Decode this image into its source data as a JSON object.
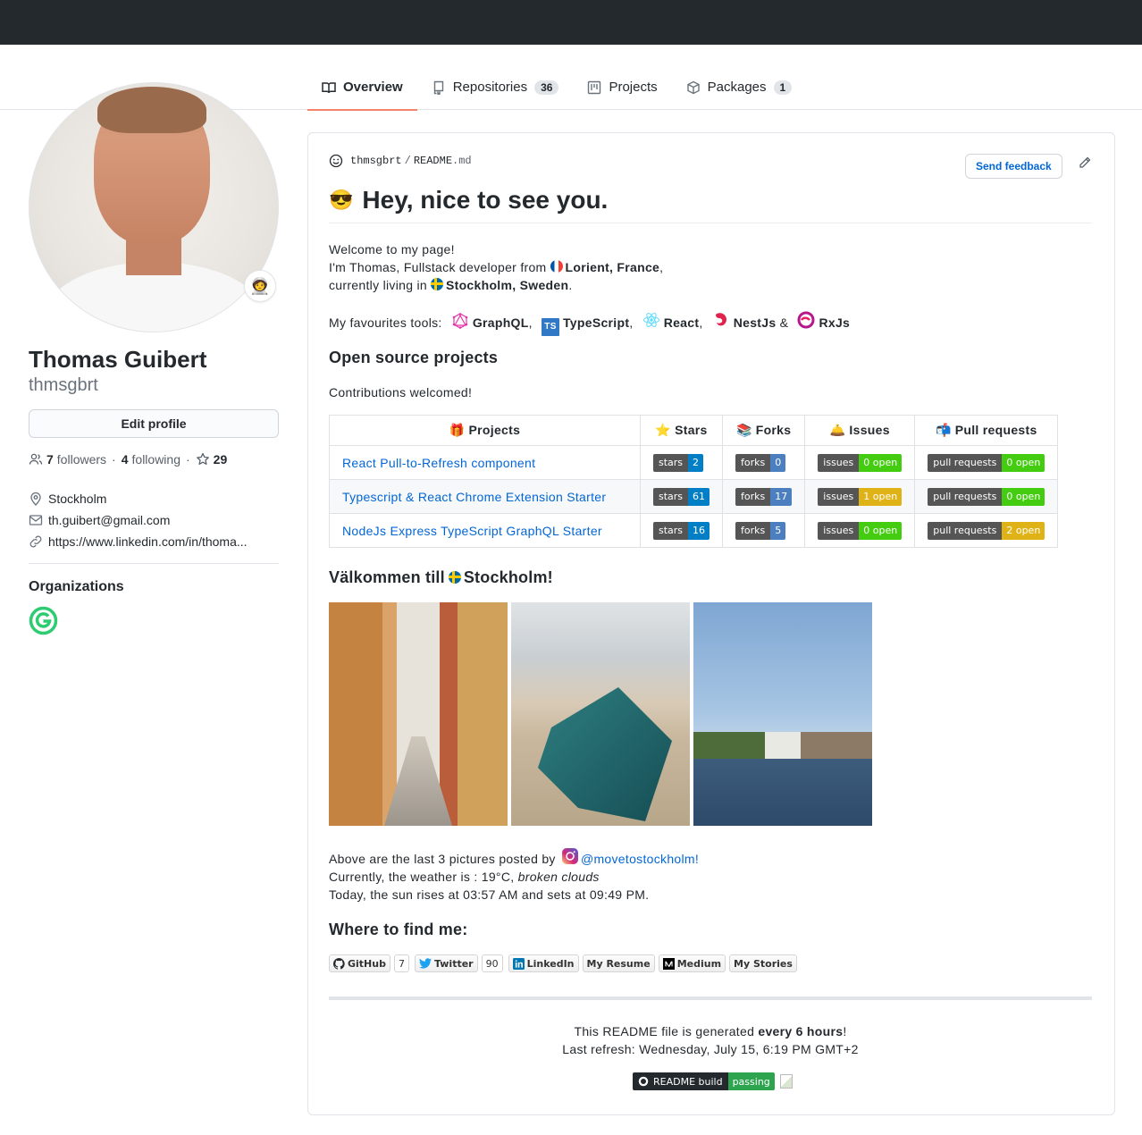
{
  "tabs": [
    {
      "label": "Overview",
      "icon": "book-icon",
      "active": true
    },
    {
      "label": "Repositories",
      "icon": "repo-icon",
      "count": "36"
    },
    {
      "label": "Projects",
      "icon": "project-icon"
    },
    {
      "label": "Packages",
      "icon": "package-icon",
      "count": "1"
    }
  ],
  "profile": {
    "name": "Thomas Guibert",
    "login": "thmsgbrt",
    "status_emoji": "🧑‍🚀",
    "edit_label": "Edit profile",
    "followers_count": "7",
    "followers_label": "followers",
    "following_count": "4",
    "following_label": "following",
    "stars_count": "29",
    "location": "Stockholm",
    "email": "th.guibert@gmail.com",
    "website": "https://www.linkedin.com/in/thoma..."
  },
  "organizations": {
    "title": "Organizations",
    "color": "#2ecc71"
  },
  "readme": {
    "path_user": "thmsgbrt",
    "path_sep": "/",
    "path_file": "README",
    "path_ext": ".md",
    "feedback_label": "Send feedback",
    "heading_emoji": "😎",
    "heading": "Hey, nice to see you.",
    "welcome": "Welcome to my page!",
    "intro_1": "I'm Thomas, Fullstack developer from",
    "intro_place_1": "Lorient, France",
    "intro_2": "currently living in",
    "intro_place_2": "Stockholm, Sweden",
    "tools_label": "My favourites tools:",
    "tools": [
      "GraphQL",
      "TypeScript",
      "React",
      "NestJs",
      "RxJs"
    ],
    "oss_title": "Open source projects",
    "contrib": "Contributions welcomed!",
    "table_headers": [
      "Projects",
      "Stars",
      "Forks",
      "Issues",
      "Pull requests"
    ],
    "table_header_icons": [
      "🎁",
      "⭐",
      "📚",
      "🛎️",
      "📬"
    ],
    "projects": [
      {
        "name": "React Pull-to-Refresh component",
        "stars": "2",
        "forks": "0",
        "issues": "0 open",
        "issues_color": "#4c1",
        "prs": "0 open",
        "prs_color": "#4c1"
      },
      {
        "name": "Typescript & React Chrome Extension Starter",
        "stars": "61",
        "forks": "17",
        "issues": "1 open",
        "issues_color": "#dfb317",
        "prs": "0 open",
        "prs_color": "#4c1"
      },
      {
        "name": "NodeJs Express TypeScript GraphQL Starter",
        "stars": "16",
        "forks": "5",
        "issues": "0 open",
        "issues_color": "#4c1",
        "prs": "2 open",
        "prs_color": "#dfb317"
      }
    ],
    "badge_labels": {
      "stars": "stars",
      "forks": "forks",
      "issues": "issues",
      "prs": "pull requests"
    },
    "badge_blue": "#007ec6",
    "badge_forks_blue": "#4c7fbf",
    "stockholm_title_1": "Välkommen till",
    "stockholm_title_2": "Stockholm!",
    "pictures_line": "Above are the last 3 pictures posted by",
    "instagram": "@movetostockholm!",
    "weather_prefix": "Currently, the weather is : 19°C,",
    "weather_desc": "broken clouds",
    "sun_line": "Today, the sun rises at 03:57 AM and sets at 09:49 PM.",
    "find_title": "Where to find me:",
    "social": [
      {
        "label": "GitHub",
        "icon": "github-icon",
        "count": "7"
      },
      {
        "label": "Twitter",
        "icon": "twitter-icon",
        "count": "90"
      },
      {
        "label": "LinkedIn",
        "icon": "linkedin-icon"
      },
      {
        "label": "My Resume"
      },
      {
        "label": "Medium",
        "icon": "medium-icon"
      },
      {
        "label": "My Stories"
      }
    ],
    "generated_1": "This README file is generated",
    "generated_bold": "every 6 hours",
    "generated_2": "!",
    "last_refresh": "Last refresh: Wednesday, July 15, 6:19 PM GMT+2",
    "build_label": "README build",
    "build_status": "passing",
    "build_color": "#2ea44f"
  }
}
